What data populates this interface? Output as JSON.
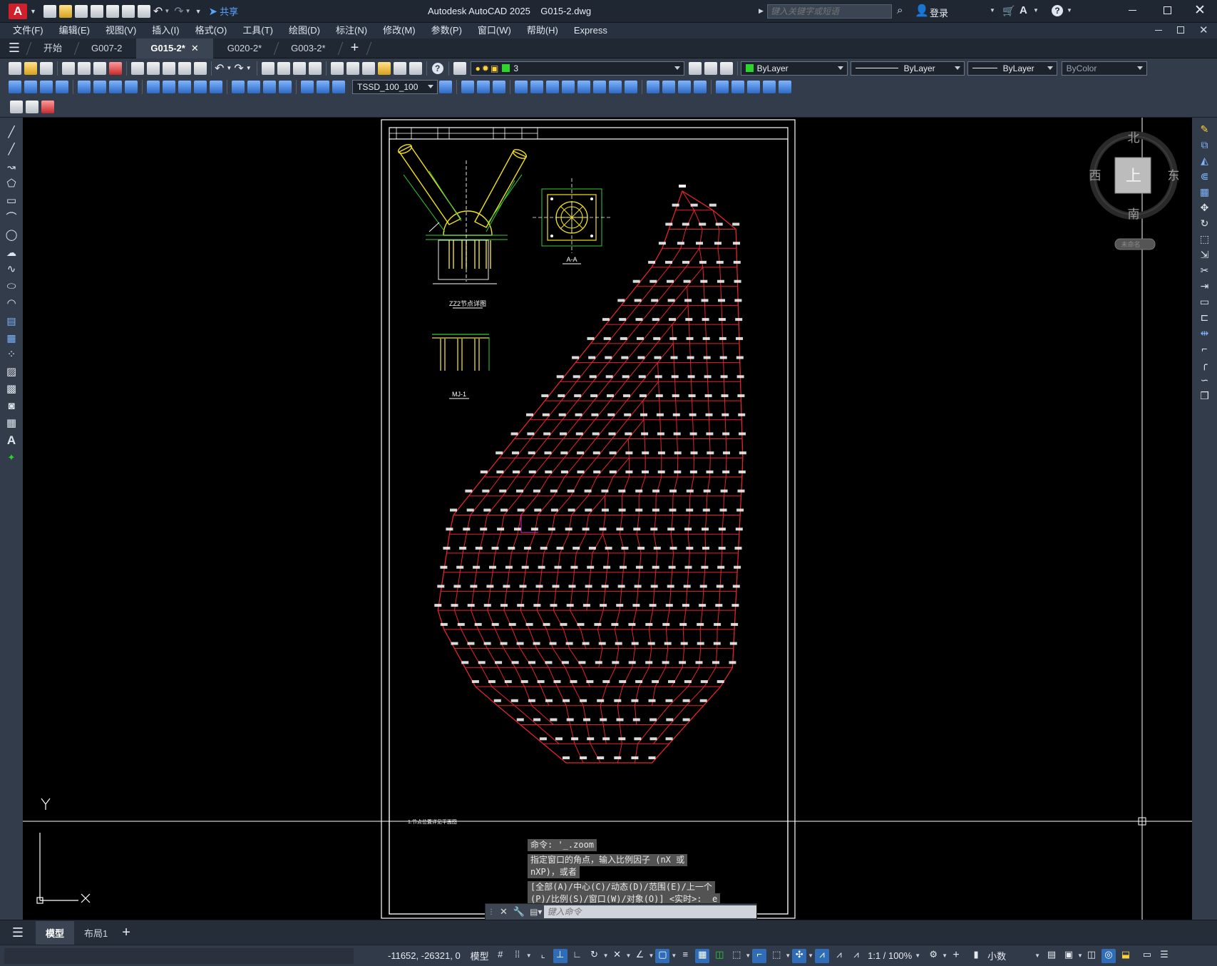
{
  "app": {
    "title": "Autodesk AutoCAD 2025",
    "file": "G015-2.dwg",
    "share_label": "共享",
    "search_placeholder": "键入关键字或短语",
    "login_label": "登录"
  },
  "menu": [
    "文件(F)",
    "编辑(E)",
    "视图(V)",
    "插入(I)",
    "格式(O)",
    "工具(T)",
    "绘图(D)",
    "标注(N)",
    "修改(M)",
    "参数(P)",
    "窗口(W)",
    "帮助(H)",
    "Express"
  ],
  "tabs": [
    {
      "label": "开始",
      "active": false
    },
    {
      "label": "G007-2",
      "active": false
    },
    {
      "label": "G015-2*",
      "active": true
    },
    {
      "label": "G020-2*",
      "active": false
    },
    {
      "label": "G003-2*",
      "active": false
    }
  ],
  "toolbar": {
    "layer_value": "3",
    "color_value": "ByLayer",
    "linetype_value": "ByLayer",
    "lineweight_value": "ByLayer",
    "plotstyle_value": "ByColor",
    "dimstyle_value": "TSSD_100_100"
  },
  "viewcube": {
    "north": "北",
    "south": "南",
    "east": "东",
    "west": "西",
    "top": "上",
    "wcs": "未命名"
  },
  "drawing": {
    "detail1_label": "ZZ2节点详图",
    "detail2_label": "A-A",
    "detail3_label": "MJ-1",
    "ucs_x": "X",
    "ucs_y": "Y",
    "bottom_note": "1.节点位置详见平面图"
  },
  "command": {
    "history": [
      "命令: '_.zoom",
      "指定窗口的角点，输入比例因子 (nX 或",
      "nXP)，或者",
      "[全部(A)/中心(C)/动态(D)/范围(E)/上一个",
      "(P)/比例(S)/窗口(W)/对象(O)] <实时>: _e"
    ],
    "placeholder": "键入命令"
  },
  "layout_tabs": [
    {
      "label": "模型",
      "active": true
    },
    {
      "label": "布局1",
      "active": false
    }
  ],
  "status": {
    "coords": "-11652, -26321, 0",
    "space": "模型",
    "scale": "1:1 / 100%",
    "units": "小数"
  },
  "colors": {
    "mesh": "#e8232a",
    "frame": "#ffffff",
    "member": "#f4e21a",
    "green": "#33cc33",
    "accent": "#2f6db8"
  }
}
